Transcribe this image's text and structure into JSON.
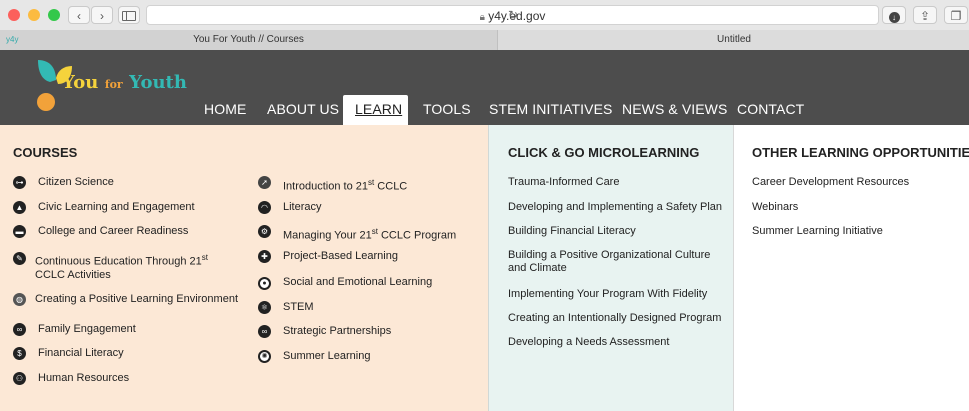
{
  "browser": {
    "url": "y4y.ed.gov",
    "tabs": [
      {
        "label": "You For Youth // Courses",
        "favicon": "y4y"
      },
      {
        "label": "Untitled"
      }
    ]
  },
  "site": {
    "logo": {
      "word1": "You",
      "word2": "for",
      "word3": "Youth"
    },
    "nav": [
      "HOME",
      "ABOUT US",
      "LEARN",
      "TOOLS",
      "STEM INITIATIVES",
      "NEWS & VIEWS",
      "CONTACT"
    ],
    "active_nav": "LEARN"
  },
  "menu": {
    "courses_heading": "COURSES",
    "courses_col1": [
      {
        "label": "Citizen Science",
        "icon": "telescope-icon"
      },
      {
        "label": "Civic Learning and Engagement",
        "icon": "civic-icon"
      },
      {
        "label": "College and Career Readiness",
        "icon": "graduation-cap-icon"
      },
      {
        "label": "Continuous Education Through 21",
        "sup": "st",
        "line2": "CCLC Activities",
        "icon": "pencil-icon"
      },
      {
        "label": "Creating a Positive Learning Environment",
        "icon": "globe-icon"
      },
      {
        "label": "Family Engagement",
        "icon": "link-icon"
      },
      {
        "label": "Financial Literacy",
        "icon": "coins-icon"
      },
      {
        "label": "Human Resources",
        "icon": "people-icon"
      }
    ],
    "courses_col2": [
      {
        "label": "Introduction to 21",
        "sup": "st",
        "label_after": " CCLC",
        "icon": "rocket-icon"
      },
      {
        "label": "Literacy",
        "icon": "book-icon"
      },
      {
        "label": "Managing Your 21",
        "sup": "st",
        "label_after": " CCLC Program",
        "icon": "gears-icon"
      },
      {
        "label": "Project-Based Learning",
        "icon": "lightbulb-icon"
      },
      {
        "label": "Social and Emotional Learning",
        "icon": "heart-icon"
      },
      {
        "label": "STEM",
        "icon": "atom-icon"
      },
      {
        "label": "Strategic Partnerships",
        "icon": "link-icon"
      },
      {
        "label": "Summer Learning",
        "icon": "sun-icon"
      }
    ],
    "click_go_heading": "CLICK & GO MICROLEARNING",
    "click_go": [
      {
        "label": "Trauma-Informed Care"
      },
      {
        "label": "Developing and Implementing a Safety Plan"
      },
      {
        "label": "Building Financial Literacy"
      },
      {
        "label": "Building a Positive Organizational Culture",
        "line2": "and Climate"
      },
      {
        "label": "Implementing Your Program With Fidelity"
      },
      {
        "label": "Creating an Intentionally Designed Program"
      },
      {
        "label": "Developing a Needs Assessment"
      }
    ],
    "other_heading": "OTHER LEARNING OPPORTUNITIES",
    "other": [
      {
        "label": "Career Development Resources"
      },
      {
        "label": "Webinars"
      },
      {
        "label": "Summer Learning Initiative"
      }
    ]
  },
  "colors": {
    "courses_bg": "#fce8d6",
    "click_go_bg": "#e8f3f1",
    "header_bg": "#4d4d4d",
    "logo_teal": "#33b9b4",
    "logo_orange": "#f2a23a",
    "logo_yellow": "#f5d33c"
  }
}
